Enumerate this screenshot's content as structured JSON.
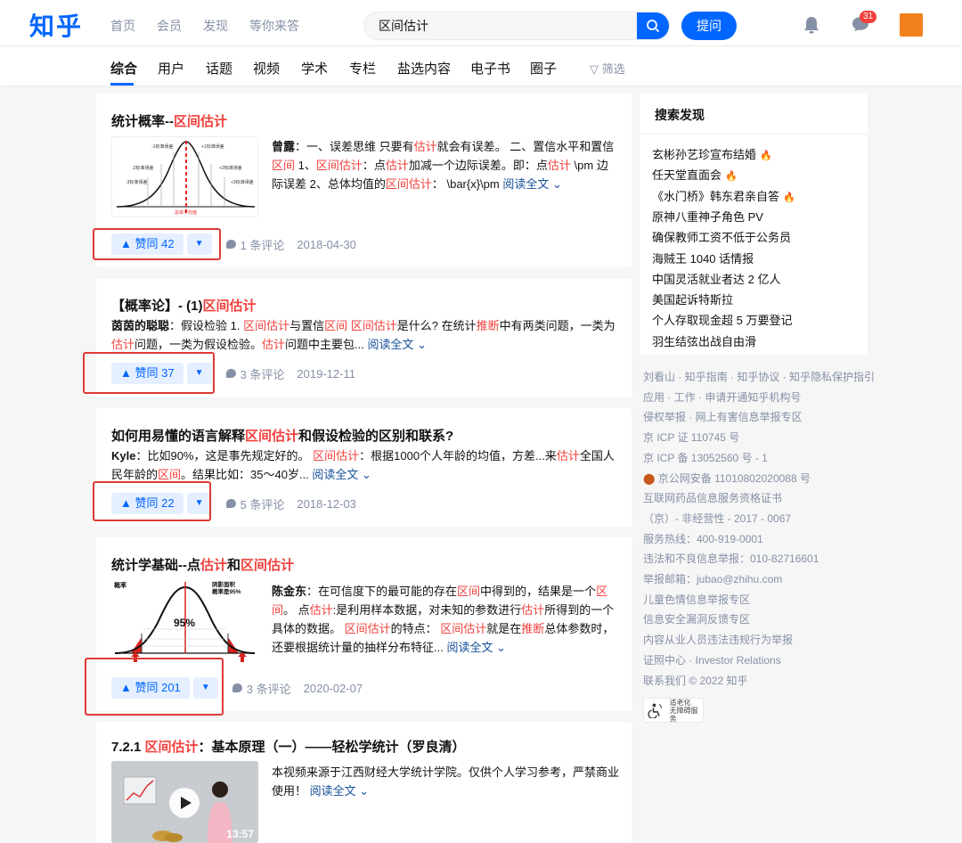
{
  "header": {
    "logo": "知乎",
    "nav": [
      "首页",
      "会员",
      "发现",
      "等你来答"
    ],
    "search_value": "区间估计",
    "ask_label": "提问",
    "msg_count": "31"
  },
  "tabs": [
    "综合",
    "用户",
    "话题",
    "视频",
    "学术",
    "专栏",
    "盐选内容",
    "电子书",
    "圈子"
  ],
  "filter_label": "筛选",
  "results": [
    {
      "title_a": "统计概率--",
      "title_hl": "区间估计",
      "thumb_labels": [
        "-1标准误差",
        "+1标准误差",
        "-2标准误差",
        "+2标准误差",
        "-3标准误差",
        "+3标准误差",
        "总体平均值"
      ],
      "excerpt_html": "<b>曾露</b>：一、误差思维 只要有<span class=\"hl\">估计</span>就会有误差。 二、置信水平和置信<span class=\"hl\">区间</span> 1、<span class=\"hl\">区间估计</span>：点<span class=\"hl\">估计</span>加减一个边际误差。即：点<span class=\"hl\">估计</span> \\pm 边际误差 2、总体均值的<span class=\"hl\">区间估计</span>： \\bar{x}\\pm <span class=\"readall\">阅读全文 ⌄</span>",
      "vote_up": "▲ 赞同 42",
      "vote_down": "▼",
      "comments": "1 条评论",
      "date": "2018-04-30"
    },
    {
      "title_a": "【概率论】- (1)",
      "title_hl": "区间估计",
      "excerpt_html": "<b>茵茵的聪聪</b>：假设检验 1. <span class=\"hl\">区间估计</span>与置信<span class=\"hl\">区间</span> <span class=\"hl\">区间估计</span>是什么? 在统计<span class=\"hl\">推断</span>中有两类问题，一类为<span class=\"hl\">估计</span>问题，一类为假设检验。<span class=\"hl\">估计</span>问题中主要包... <span class=\"readall\">阅读全文 ⌄</span>",
      "vote_up": "▲ 赞同 37",
      "vote_down": "▼",
      "comments": "3 条评论",
      "date": "2019-12-11"
    },
    {
      "title_a": "如何用易懂的语言解释",
      "title_hl": "区间估计",
      "title_b": "和假设检验的区别和联系?",
      "excerpt_html": "<b>Kyle</b>：比如90%，这是事先规定好的。 <span class=\"hl\">区间估计</span>：根据1000个人年龄的均值，方差...来<span class=\"hl\">估计</span>全国人民年龄的<span class=\"hl\">区间</span>。结果比如：35～40岁... <span class=\"readall\">阅读全文 ⌄</span>",
      "vote_up": "▲ 赞同 22",
      "vote_down": "▼",
      "comments": "5 条评论",
      "date": "2018-12-03"
    },
    {
      "title_a": "统计学基础--点",
      "title_hl": "估计",
      "title_b": "和",
      "title_hl2": "区间估计",
      "thumb_labels": [
        "概率",
        "阴影面积",
        "概率是95%",
        "95%"
      ],
      "excerpt_html": "<b>陈金东</b>：在可信度下的最可能的存在<span class=\"hl\">区间</span>中得到的，结果是一个<span class=\"hl\">区间</span>。 点<span class=\"hl\">估计</span>:是利用样本数据，对未知的参数进行<span class=\"hl\">估计</span>所得到的一个具体的数据。 <span class=\"hl\">区间估计</span>的特点： <span class=\"hl\">区间估计</span>就是在<span class=\"hl\">推断</span>总体参数时，还要根据统计量的抽样分布特征... <span class=\"readall\">阅读全文 ⌄</span>",
      "vote_up": "▲ 赞同 201",
      "vote_down": "▼",
      "comments": "3 条评论",
      "date": "2020-02-07"
    },
    {
      "title_a": "7.2.1 ",
      "title_hl": "区间估计",
      "title_b": "：基本原理（一）——轻松学统计（罗良清）",
      "excerpt_html": "本视频来源于江西财经大学统计学院。仅供个人学习参考，严禁商业使用！ <span class=\"readall\">阅读全文 ⌄</span>",
      "duration": "13:57"
    }
  ],
  "sidebar": {
    "title": "搜索发现",
    "items": [
      {
        "text": "玄彬孙艺珍宣布结婚",
        "hot": true
      },
      {
        "text": "任天堂直面会",
        "hot": true
      },
      {
        "text": "《水门桥》韩东君亲自答",
        "hot": true
      },
      {
        "text": "原神八重神子角色 PV",
        "hot": false
      },
      {
        "text": "确保教师工资不低于公务员",
        "hot": false
      },
      {
        "text": "海贼王 1040 话情报",
        "hot": false
      },
      {
        "text": "中国灵活就业者达 2 亿人",
        "hot": false
      },
      {
        "text": "美国起诉特斯拉",
        "hot": false
      },
      {
        "text": "个人存取现金超 5 万要登记",
        "hot": false
      },
      {
        "text": "羽生结弦出战自由滑",
        "hot": false
      }
    ]
  },
  "footer": [
    "刘看山 · 知乎指南 · 知乎协议 · 知乎隐私保护指引",
    "应用 · 工作 · 申请开通知乎机构号",
    "侵权举报 · 网上有害信息举报专区",
    "京 ICP 证 110745 号",
    "京 ICP 备 13052560 号 - 1",
    "京公网安备 11010802020088 号",
    "互联网药品信息服务资格证书",
    "（京）- 非经营性 - 2017 - 0067",
    "服务热线：400-919-0001",
    "违法和不良信息举报：010-82716601",
    "举报邮箱：jubao@zhihu.com",
    "儿童色情信息举报专区",
    "信息安全漏洞反馈专区",
    "内容从业人员违法违规行为举报",
    "证照中心 · Investor Relations",
    "联系我们 © 2022 知乎"
  ],
  "a11y_label": [
    "适老化",
    "无障碍服务"
  ]
}
